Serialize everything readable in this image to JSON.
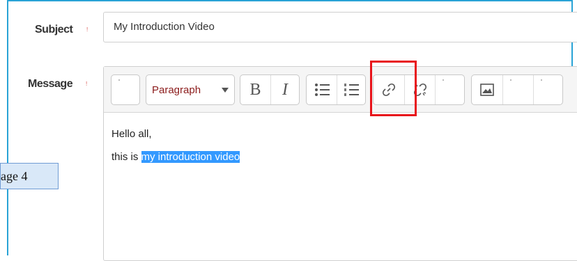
{
  "form": {
    "subject_label": "Subject",
    "subject_value": "My Introduction Video",
    "message_label": "Message",
    "required_marker": "!"
  },
  "toolbar": {
    "paragraph_label": "Paragraph",
    "bold_label": "B",
    "italic_label": "I"
  },
  "editor": {
    "line1": "Hello all,",
    "line2_prefix": "this is ",
    "line2_selected": "my introduction video"
  },
  "page_tag": "age 4",
  "colors": {
    "frame": "#29a3d6",
    "highlight_box": "#e8141b",
    "selection": "#3399ff"
  }
}
